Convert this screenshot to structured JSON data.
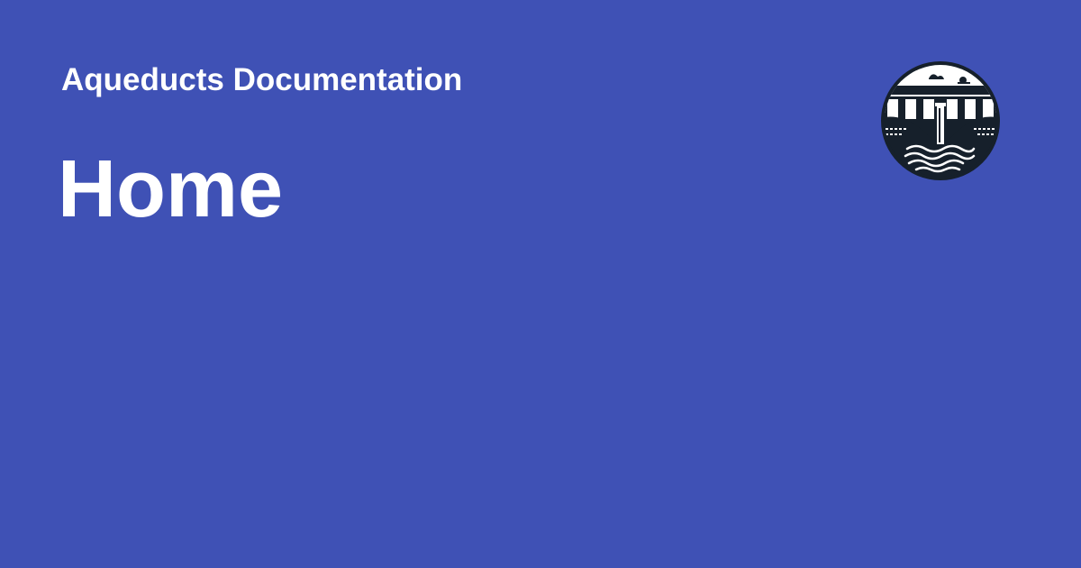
{
  "site": {
    "name": "Aqueducts Documentation"
  },
  "page": {
    "title": "Home"
  },
  "logo": {
    "icon": "aqueduct-logo-icon"
  },
  "colors": {
    "background": "#3f51b5",
    "text": "#ffffff",
    "logo_dark": "#16202b",
    "logo_light": "#ffffff"
  }
}
